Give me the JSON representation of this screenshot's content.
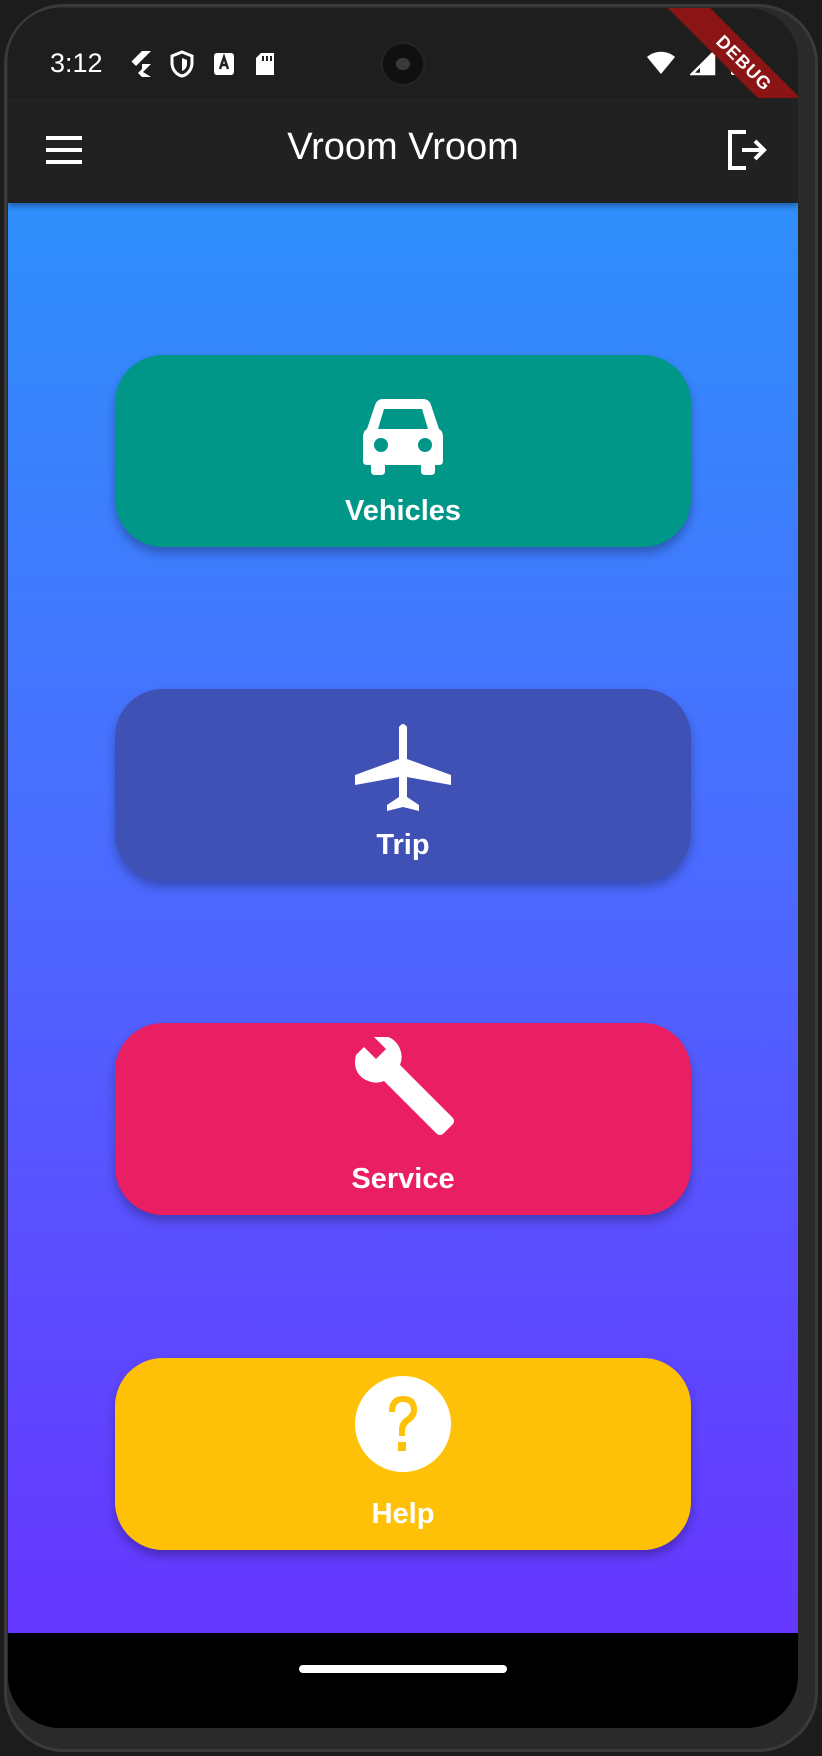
{
  "status_bar": {
    "time": "3:12"
  },
  "debug_banner": "DEBUG",
  "app_bar": {
    "title": "Vroom Vroom"
  },
  "tiles": [
    {
      "label": "Vehicles",
      "icon": "car-icon",
      "color": "#009688"
    },
    {
      "label": "Trip",
      "icon": "airplane-icon",
      "color": "#3f51b5"
    },
    {
      "label": "Service",
      "icon": "wrench-icon",
      "color": "#e91e63"
    },
    {
      "label": "Help",
      "icon": "help-circle-icon",
      "color": "#ffc107"
    }
  ],
  "colors": {
    "app_bar": "#212121",
    "gradient_top": "#2f8ffb",
    "gradient_bottom": "#6537ff"
  }
}
